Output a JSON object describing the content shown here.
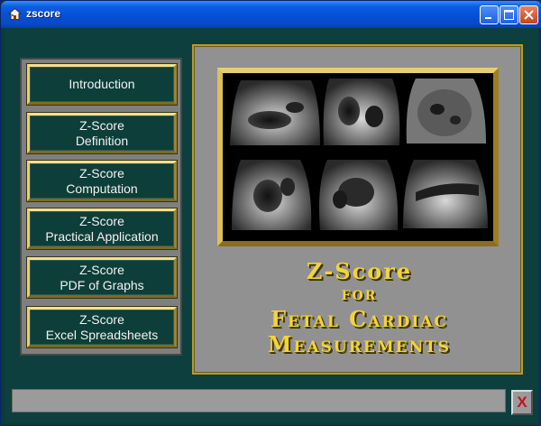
{
  "window": {
    "title": "zscore",
    "icons": {
      "app": "house-icon",
      "minimize": "minimize-icon",
      "maximize": "maximize-icon",
      "close": "close-icon"
    }
  },
  "nav": {
    "items": [
      {
        "label": "Introduction"
      },
      {
        "label": "Z-Score\nDefinition"
      },
      {
        "label": "Z-Score\nComputation"
      },
      {
        "label": "Z-Score\nPractical Application"
      },
      {
        "label": "Z-Score\nPDF of Graphs"
      },
      {
        "label": "Z-Score\nExcel Spreadsheets"
      }
    ]
  },
  "main": {
    "headline_lines": [
      "Z-Score",
      "for",
      "Fetal Cardiac",
      "Measurements"
    ]
  },
  "footer": {
    "exit_label": "X"
  },
  "colors": {
    "title_bar": "#0651d8",
    "background": "#0c3f3e",
    "gold": "#c7a53a",
    "headline": "#f1d43a",
    "exit": "#c0141a"
  }
}
